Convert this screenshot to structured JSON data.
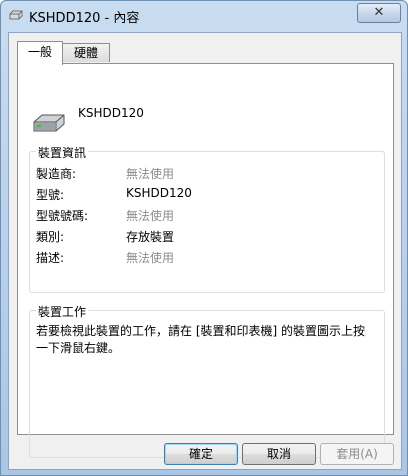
{
  "window": {
    "title": "KSHDD120 - 內容",
    "close_label": "✕",
    "title_icon": "drive-icon"
  },
  "tabs": [
    {
      "label": "一般",
      "active": true
    },
    {
      "label": "硬體",
      "active": false
    }
  ],
  "device": {
    "name": "KSHDD120",
    "icon": "hard-drive-icon"
  },
  "device_info": {
    "title": "裝置資訊",
    "rows": [
      {
        "label": "製造商:",
        "value": "無法使用"
      },
      {
        "label": "型號:",
        "value": "KSHDD120"
      },
      {
        "label": "型號號碼:",
        "value": "無法使用"
      },
      {
        "label": "類別:",
        "value": "存放裝置"
      },
      {
        "label": "描述:",
        "value": "無法使用"
      }
    ]
  },
  "device_tasks": {
    "title": "裝置工作",
    "description": "若要檢視此裝置的工作，請在 [裝置和印表機] 的裝置圖示上按一下滑鼠右鍵。"
  },
  "buttons": {
    "ok": "確定",
    "cancel": "取消",
    "apply": "套用(A)"
  }
}
